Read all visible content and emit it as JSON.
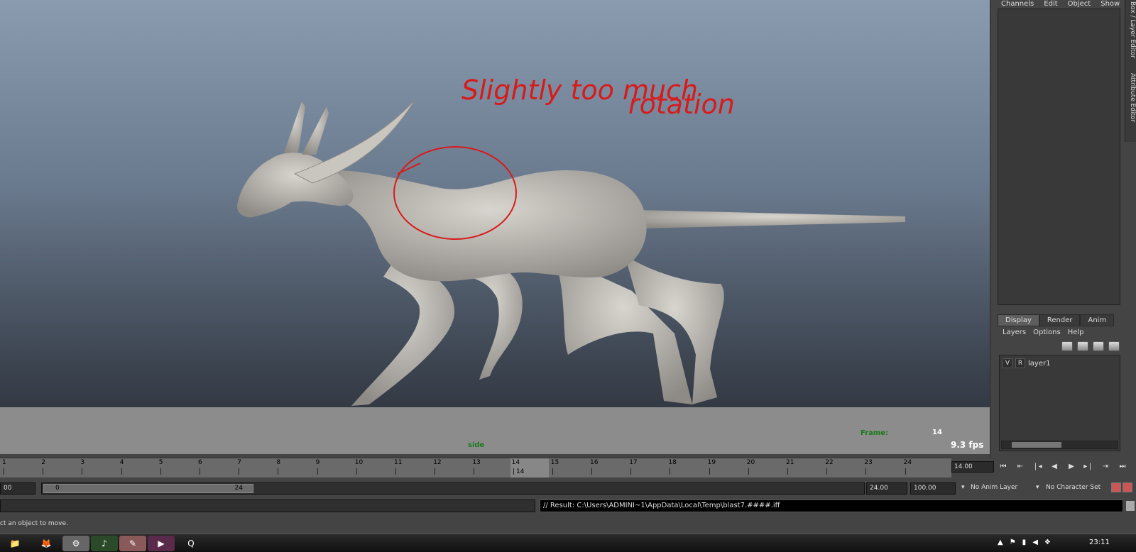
{
  "annotation": {
    "line1": "Slightly too much",
    "line2": "rotation",
    "color": "#d81a1a"
  },
  "viewport": {
    "camera": "side",
    "frame_label": "Frame:",
    "frame_value": "14",
    "fps": "9.3 fps"
  },
  "channel_box": {
    "menu": [
      "Channels",
      "Edit",
      "Object",
      "Show"
    ]
  },
  "side_tabs": {
    "top": "Box / Layer Editor",
    "bottom": "Attribute Editor"
  },
  "layer_editor": {
    "tabs": [
      "Display",
      "Render",
      "Anim"
    ],
    "menu": [
      "Layers",
      "Options",
      "Help"
    ],
    "layer": {
      "v": "V",
      "r": "R",
      "name": "layer1"
    }
  },
  "time_slider": {
    "ticks": [
      "1",
      "2",
      "3",
      "4",
      "5",
      "6",
      "7",
      "8",
      "9",
      "10",
      "11",
      "12",
      "13",
      "14",
      "15",
      "16",
      "17",
      "18",
      "19",
      "20",
      "21",
      "22",
      "23",
      "24"
    ],
    "current_sub": "14",
    "current_time": "14.00"
  },
  "range": {
    "start": "00",
    "bar_start": "0",
    "bar_end": "24",
    "end": "24.00",
    "playback_end": "100.00",
    "anim_layer": "No Anim Layer",
    "char_set": "No Character Set"
  },
  "command": {
    "result": "// Result: C:\\Users\\ADMINI~1\\AppData\\Local\\Temp\\blast7.####.iff"
  },
  "help_line": "ct an object to move.",
  "taskbar": {
    "clock": "23:11"
  }
}
